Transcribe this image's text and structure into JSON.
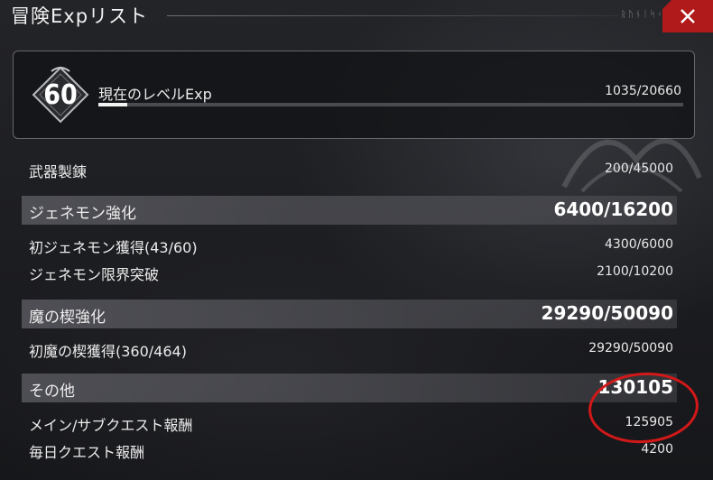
{
  "window": {
    "title": "冒険Expリスト",
    "title_glyphs": "ᚱᚢᚾᛁᛋᚲᚺ",
    "close_label": "×"
  },
  "level": {
    "number": "60",
    "label": "現在のレベルExp",
    "value": "1035/20660",
    "progress_fraction": 0.05
  },
  "rows": [
    {
      "label": "武器製錬",
      "value": "200/45000"
    },
    {
      "label": "ジェネモン強化",
      "value": "6400/16200"
    },
    {
      "label": "初ジェネモン獲得(43/60)",
      "value": "4300/6000"
    },
    {
      "label": "ジェネモン限界突破",
      "value": "2100/10200"
    },
    {
      "label": "魔の楔強化",
      "value": "29290/50090"
    },
    {
      "label": "初魔の楔獲得(360/464)",
      "value": "29290/50090"
    },
    {
      "label": "その他",
      "value": "130105"
    },
    {
      "label": "メイン/サブクエスト報酬",
      "value": "125905"
    },
    {
      "label": "毎日クエスト報酬",
      "value": "4200"
    }
  ],
  "colors": {
    "accent_close": "#b01a1a",
    "annotation_circle": "#d21818"
  }
}
